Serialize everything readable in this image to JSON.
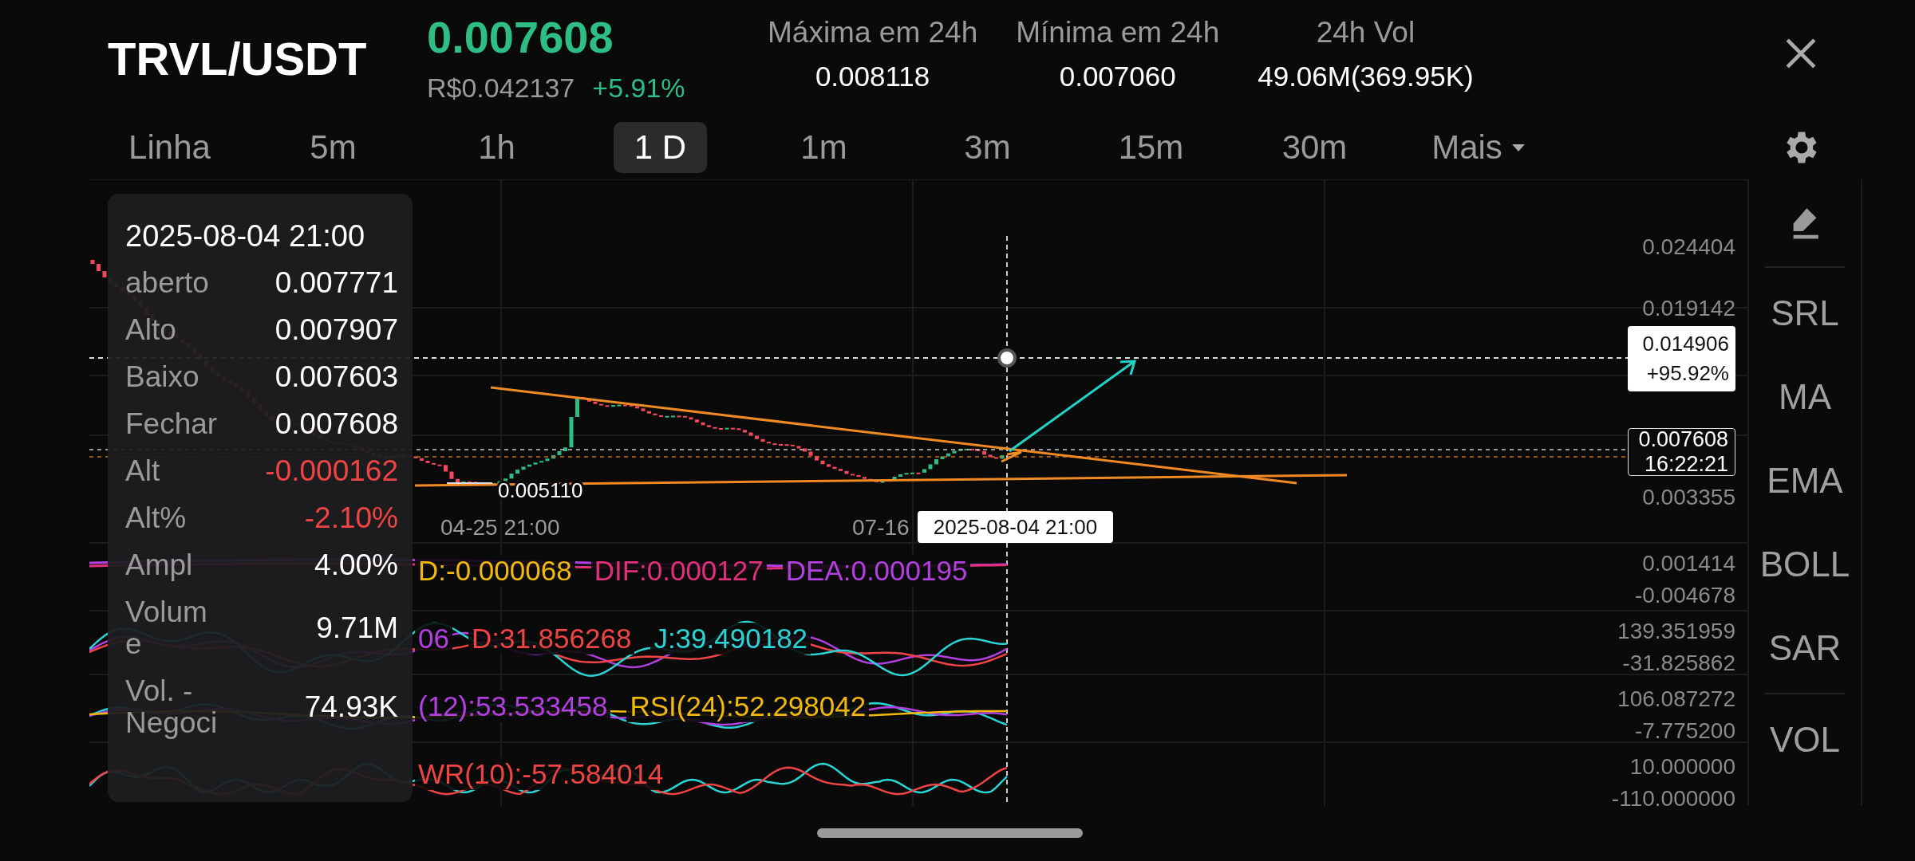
{
  "pair": "TRVL/USDT",
  "price": "0.007608",
  "fiat_price": "R$0.042137",
  "change": "+5.91%",
  "stats": [
    {
      "label": "Máxima em 24h",
      "value": "0.008118"
    },
    {
      "label": "Mínima em 24h",
      "value": "0.007060"
    },
    {
      "label": "24h Vol",
      "value": "49.06M(369.95K)"
    }
  ],
  "tabs": [
    {
      "label": "Linha",
      "selected": false,
      "dropdown": false
    },
    {
      "label": "5m",
      "selected": false,
      "dropdown": false
    },
    {
      "label": "1h",
      "selected": false,
      "dropdown": false
    },
    {
      "label": "1 D",
      "selected": true,
      "dropdown": false
    },
    {
      "label": "1m",
      "selected": false,
      "dropdown": false
    },
    {
      "label": "3m",
      "selected": false,
      "dropdown": false
    },
    {
      "label": "15m",
      "selected": false,
      "dropdown": false
    },
    {
      "label": "30m",
      "selected": false,
      "dropdown": false
    },
    {
      "label": "Mais",
      "selected": false,
      "dropdown": true
    }
  ],
  "chart": {
    "price_axis": [
      "0.024404",
      "0.019142",
      "0.003355"
    ],
    "low_label": "0.005110",
    "time_axis": [
      "04-25 21:00",
      "07-16"
    ],
    "crosshair_time": "2025-08-04 21:00",
    "target": {
      "price": "0.014906",
      "change": "+95.92%"
    },
    "current": {
      "price": "0.007608",
      "countdown": "16:22:21"
    }
  },
  "tooltip": {
    "time": "2025-08-04 21:00",
    "rows": [
      {
        "label": "aberto",
        "value": "0.007771",
        "negative": false
      },
      {
        "label": "Alto",
        "value": "0.007907",
        "negative": false
      },
      {
        "label": "Baixo",
        "value": "0.007603",
        "negative": false
      },
      {
        "label": "Fechar",
        "value": "0.007608",
        "negative": false
      },
      {
        "label": "Alt",
        "value": "-0.000162",
        "negative": true
      },
      {
        "label": "Alt%",
        "value": "-2.10%",
        "negative": true
      },
      {
        "label": "Ampl",
        "value": "4.00%",
        "negative": false
      },
      {
        "label": "Volume",
        "value": "9.71M",
        "negative": false
      },
      {
        "label": "Vol. - Negoci",
        "value": "74.93K",
        "negative": false
      }
    ]
  },
  "indicators": [
    {
      "legend": [
        {
          "text": "D:-0.000068",
          "color": "#f0b90b"
        },
        {
          "text": "DIF:0.000127",
          "color": "#e0307a"
        },
        {
          "text": "DEA:0.000195",
          "color": "#b23fe0"
        }
      ],
      "scale": [
        "0.001414",
        "-0.004678"
      ]
    },
    {
      "legend": [
        {
          "text": "06",
          "color": "#b23fe0"
        },
        {
          "text": "D:31.856268",
          "color": "#ef4444"
        },
        {
          "text": "J:39.490182",
          "color": "#2ad4d4"
        }
      ],
      "scale": [
        "139.351959",
        "-31.825862"
      ]
    },
    {
      "legend": [
        {
          "text": "(12):53.533458",
          "color": "#b23fe0"
        },
        {
          "text": "RSI(24):52.298042",
          "color": "#f0b90b"
        }
      ],
      "scale": [
        "106.087272",
        "-7.775200"
      ]
    },
    {
      "legend": [
        {
          "text": "WR(10):-57.584014",
          "color": "#ef4444"
        }
      ],
      "scale": [
        "10.000000",
        "-110.000000"
      ]
    }
  ],
  "sidebar_groups": [
    {
      "items": [
        {
          "kind": "draw-tool"
        }
      ]
    },
    {
      "items": [
        {
          "kind": "indicator",
          "label": "SRL"
        },
        {
          "kind": "indicator",
          "label": "MA"
        },
        {
          "kind": "indicator",
          "label": "EMA"
        },
        {
          "kind": "indicator",
          "label": "BOLL"
        },
        {
          "kind": "indicator",
          "label": "SAR"
        }
      ]
    },
    {
      "items": [
        {
          "kind": "indicator",
          "label": "VOL"
        }
      ]
    }
  ]
}
